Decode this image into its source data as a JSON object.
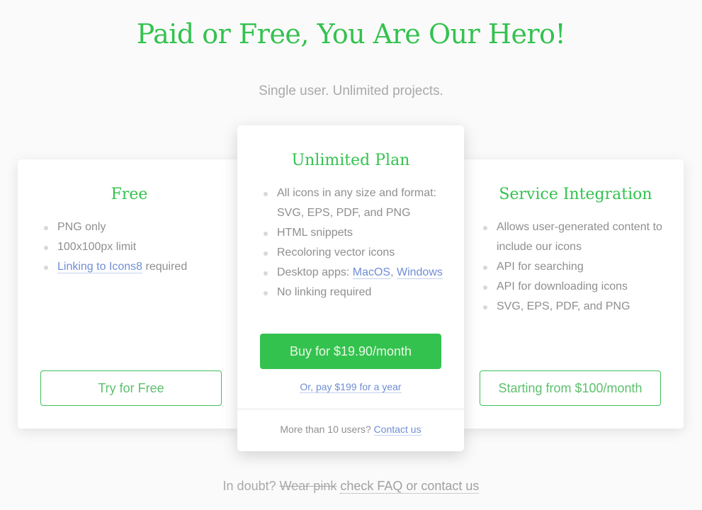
{
  "header": {
    "title": "Paid or Free, You Are Our Hero!",
    "subtitle": "Single user. Unlimited projects."
  },
  "colors": {
    "accent": "#34c24f",
    "link": "#6f8ed6",
    "text": "#8f8f8f",
    "background": "#fafafa"
  },
  "plans": {
    "free": {
      "title": "Free",
      "features": [
        "PNG only",
        "100x100px limit"
      ],
      "link_feature": {
        "link": "Linking to Icons8",
        "suffix": " required"
      },
      "button": "Try for Free"
    },
    "unlimited": {
      "title": "Unlimited Plan",
      "features": [
        "All icons in any size and format: SVG, EPS, PDF, and PNG",
        "HTML snippets",
        "Recoloring vector icons"
      ],
      "desktop_feature": {
        "prefix": "Desktop apps: ",
        "link1": "MacOS",
        "sep": ", ",
        "link2": "Windows"
      },
      "last_feature": "No linking required",
      "button": "Buy for $19.90/month",
      "alt_price": "Or, pay $199 for a year",
      "more_users": "More than 10 users? ",
      "contact": "Contact us"
    },
    "service": {
      "title": "Service Integration",
      "features": [
        "Allows user-generated content to include our icons",
        "API for searching",
        "API for downloading icons",
        "SVG, EPS, PDF, and PNG"
      ],
      "button": "Starting from $100/month"
    }
  },
  "footer": {
    "prefix": "In doubt? ",
    "strike": "Wear pink",
    "faq": "check FAQ",
    "or": " or ",
    "contact": "contact us"
  }
}
